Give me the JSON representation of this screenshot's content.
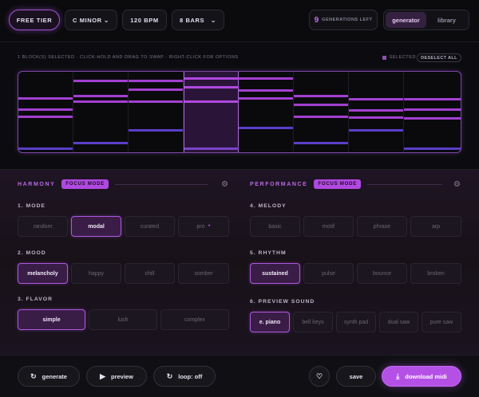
{
  "topbar": {
    "tier": "FREE TIER",
    "key": "C MINOR",
    "bpm": "120 BPM",
    "bars": "8 BARS",
    "generations_count": "9",
    "generations_label": "GENERATIONS LEFT",
    "tab_generator": "generator",
    "tab_library": "library"
  },
  "grid": {
    "status": "1 BLOCK(S) SELECTED · CLICK-HOLD AND DRAG TO SWAP · RIGHT-CLICK FOR OPTIONS",
    "selected_label": "SELECTED",
    "deselect_label": "DESELECT ALL",
    "selected_block_number": 4,
    "colors": {
      "note": "#a33fd1",
      "bass": "#5a3ec8",
      "grid_border": "#7d47a8"
    }
  },
  "harmony": {
    "title": "HARMONY",
    "focus": "FOCUS MODE",
    "mode": {
      "label": "1. MODE",
      "options": [
        "random",
        "modal",
        "curated",
        "pro"
      ],
      "selected": "modal"
    },
    "mood": {
      "label": "2. MOOD",
      "options": [
        "melancholy",
        "happy",
        "chill",
        "somber"
      ],
      "selected": "melancholy"
    },
    "flavor": {
      "label": "3. FLAVOR",
      "options": [
        "simple",
        "lush",
        "complex"
      ],
      "selected": "simple"
    }
  },
  "performance": {
    "title": "PERFORMANCE",
    "focus": "FOCUS MODE",
    "melody": {
      "label": "4. MELODY",
      "options": [
        "basic",
        "motif",
        "phrase",
        "arp"
      ]
    },
    "rhythm": {
      "label": "5. RHYTHM",
      "options": [
        "sustained",
        "pulse",
        "bounce",
        "broken"
      ],
      "selected": "sustained"
    },
    "sound": {
      "label": "6. PREVIEW SOUND",
      "options": [
        "e. piano",
        "bell keys",
        "synth pad",
        "dual saw",
        "pure saw"
      ],
      "selected": "e. piano"
    }
  },
  "bottom": {
    "generate": "generate",
    "preview": "preview",
    "loop": "loop: off",
    "save": "save",
    "download": "download midi"
  }
}
